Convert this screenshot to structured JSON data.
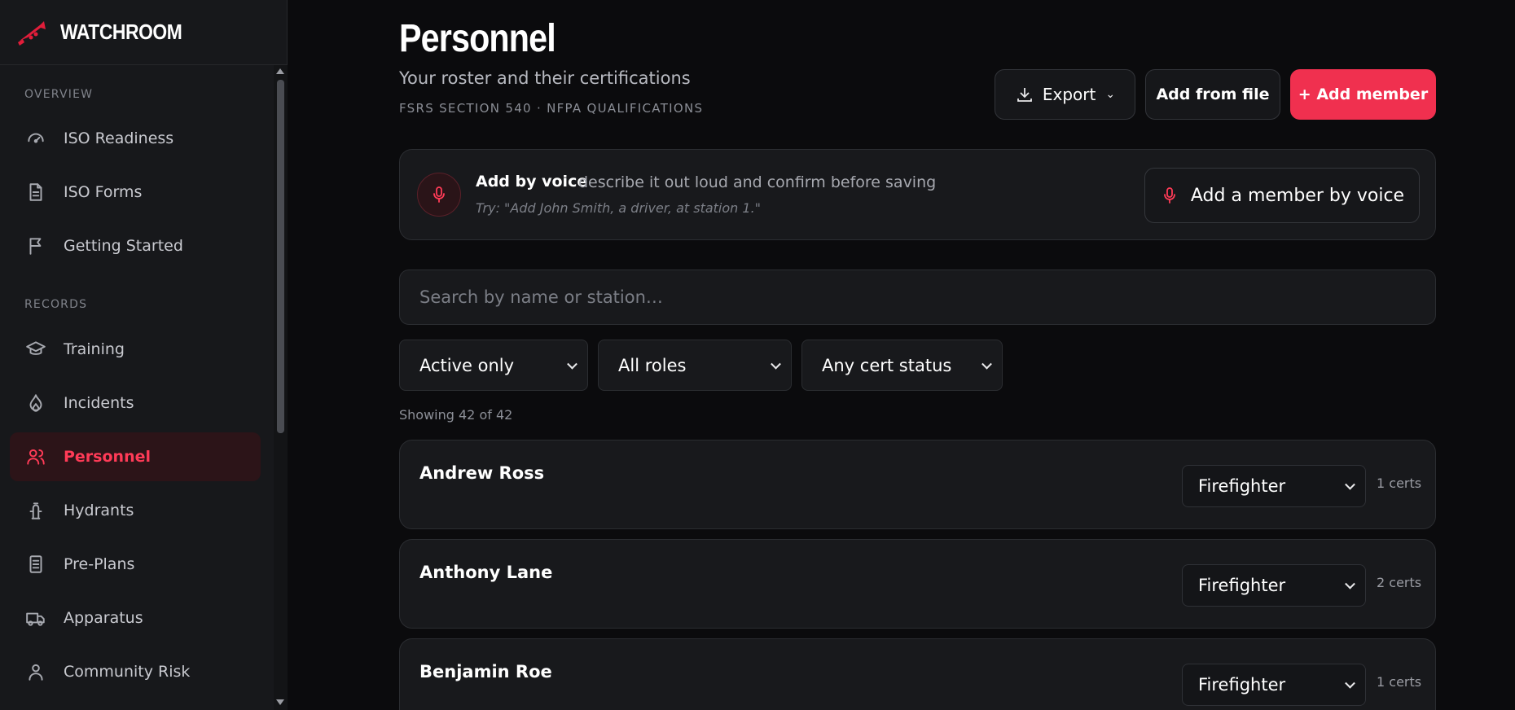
{
  "app": {
    "name": "WATCHROOM",
    "accent_color": "#f0304f"
  },
  "sidebar": {
    "sections": [
      {
        "label": "OVERVIEW",
        "items": [
          {
            "label": "ISO Readiness",
            "icon": "gauge-icon"
          },
          {
            "label": "ISO Forms",
            "icon": "document-icon"
          },
          {
            "label": "Getting Started",
            "icon": "flag-icon"
          }
        ]
      },
      {
        "label": "RECORDS",
        "items": [
          {
            "label": "Training",
            "icon": "graduation-cap-icon"
          },
          {
            "label": "Incidents",
            "icon": "flame-icon"
          },
          {
            "label": "Personnel",
            "icon": "users-icon",
            "active": true
          },
          {
            "label": "Hydrants",
            "icon": "hydrant-icon"
          },
          {
            "label": "Pre-Plans",
            "icon": "clipboard-icon"
          },
          {
            "label": "Apparatus",
            "icon": "truck-icon"
          },
          {
            "label": "Community Risk",
            "icon": "person-icon"
          }
        ]
      }
    ]
  },
  "page": {
    "title": "Personnel",
    "subtitle": "Your roster and their certifications",
    "standard": "FSRS SECTION 540 · NFPA QUALIFICATIONS"
  },
  "toolbar": {
    "export_label": "Export",
    "add_from_file_label": "Add from file",
    "add_member_label": "+ Add member"
  },
  "voice": {
    "title": "Add by voice",
    "description": "describe it out loud and confirm before saving",
    "example": "Try: \"Add John Smith, a driver, at station 1.\"",
    "button_label": "Add a member by voice"
  },
  "search": {
    "placeholder": "Search by name or station…",
    "value": ""
  },
  "filters": {
    "status": "Active only",
    "role": "All roles",
    "cert_status": "Any cert status"
  },
  "results": {
    "showing_text": "Showing 42 of 42"
  },
  "personnel": [
    {
      "name": "Andrew Ross",
      "role": "Firefighter",
      "certs": "1 certs"
    },
    {
      "name": "Anthony Lane",
      "role": "Firefighter",
      "certs": "2 certs"
    },
    {
      "name": "Benjamin Roe",
      "role": "Firefighter",
      "certs": "1 certs"
    }
  ]
}
